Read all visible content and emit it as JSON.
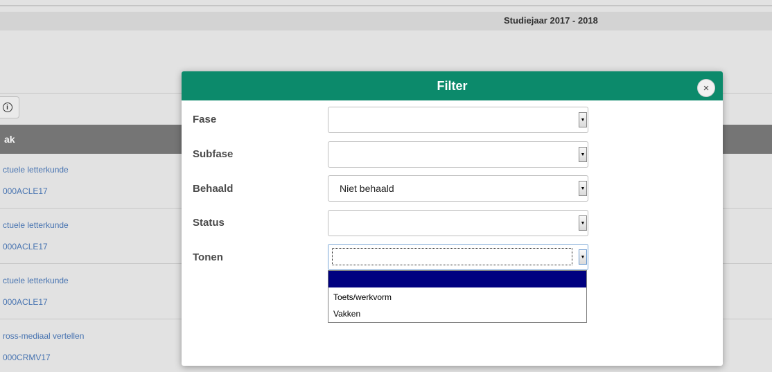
{
  "background": {
    "academic_year": "Studiejaar 2017 - 2018",
    "table_header": "ak",
    "rows": [
      {
        "title": "ctuele letterkunde",
        "code": "000ACLE17"
      },
      {
        "title": "ctuele letterkunde",
        "code": "000ACLE17"
      },
      {
        "title": "ctuele letterkunde",
        "code": "000ACLE17"
      },
      {
        "title": "ross-mediaal vertellen",
        "code": "000CRMV17"
      }
    ]
  },
  "modal": {
    "title": "Filter",
    "close_symbol": "×",
    "fields": [
      {
        "label": "Fase",
        "value": ""
      },
      {
        "label": "Subfase",
        "value": ""
      },
      {
        "label": "Behaald",
        "value": "Niet behaald"
      },
      {
        "label": "Status",
        "value": ""
      },
      {
        "label": "Tonen",
        "value": ""
      }
    ],
    "tonen_options": [
      "",
      "Toets/werkvorm",
      "Vakken"
    ]
  },
  "icons": {
    "info": "info-icon",
    "close": "close-icon",
    "dropdown_arrow": "chevron-down-icon"
  },
  "colors": {
    "header_accent": "#0c8a6b",
    "selected_option": "#000080",
    "link": "#4a78b8"
  }
}
